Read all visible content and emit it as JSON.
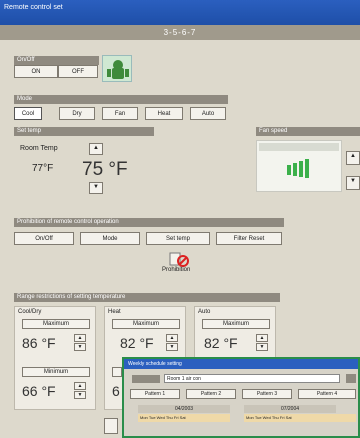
{
  "window": {
    "title": "Remote control set",
    "subtitle": "3-5-6-7"
  },
  "onoff": {
    "section": "On/Off",
    "on_label": "ON",
    "off_label": "OFF"
  },
  "mode": {
    "section": "Mode",
    "items": [
      "Cool",
      "Dry",
      "Fan",
      "Heat",
      "Auto"
    ],
    "selected": "Cool"
  },
  "settemp": {
    "section": "Set temp",
    "room_label": "Room Temp",
    "room_value": "77°F",
    "set_value": "75 °F"
  },
  "fanspeed": {
    "section": "Fan speed"
  },
  "prohibition": {
    "section": "Prohibition of remote control operation",
    "buttons": [
      "On/Off",
      "Mode",
      "Set temp",
      "Filter Reset"
    ],
    "prohibit_label": "Prohibition"
  },
  "range": {
    "section": "Range restrictions of setting temperature",
    "groups": [
      {
        "name": "Cool/Dry",
        "max_label": "Maximum",
        "max_value": "86 °F",
        "min_label": "Minimum",
        "min_value": "66 °F"
      },
      {
        "name": "Heat",
        "max_label": "Maximum",
        "max_value": "82 °F",
        "min_label": "Minimum",
        "min_value": "6"
      },
      {
        "name": "Auto",
        "max_label": "Maximum",
        "max_value": "82 °F"
      }
    ]
  },
  "overlay": {
    "title": "Weekly schedule setting",
    "room_value": "Room 1 air con",
    "tabs": [
      "Pattern 1",
      "Pattern 2",
      "Pattern 3",
      "Pattern 4"
    ],
    "date1": "04/2003",
    "date2": "07/2004",
    "days1": "Mon Tue Wed Thu Fri Sat",
    "days2": "Mon Tue Wed Thu Fri Sat"
  }
}
